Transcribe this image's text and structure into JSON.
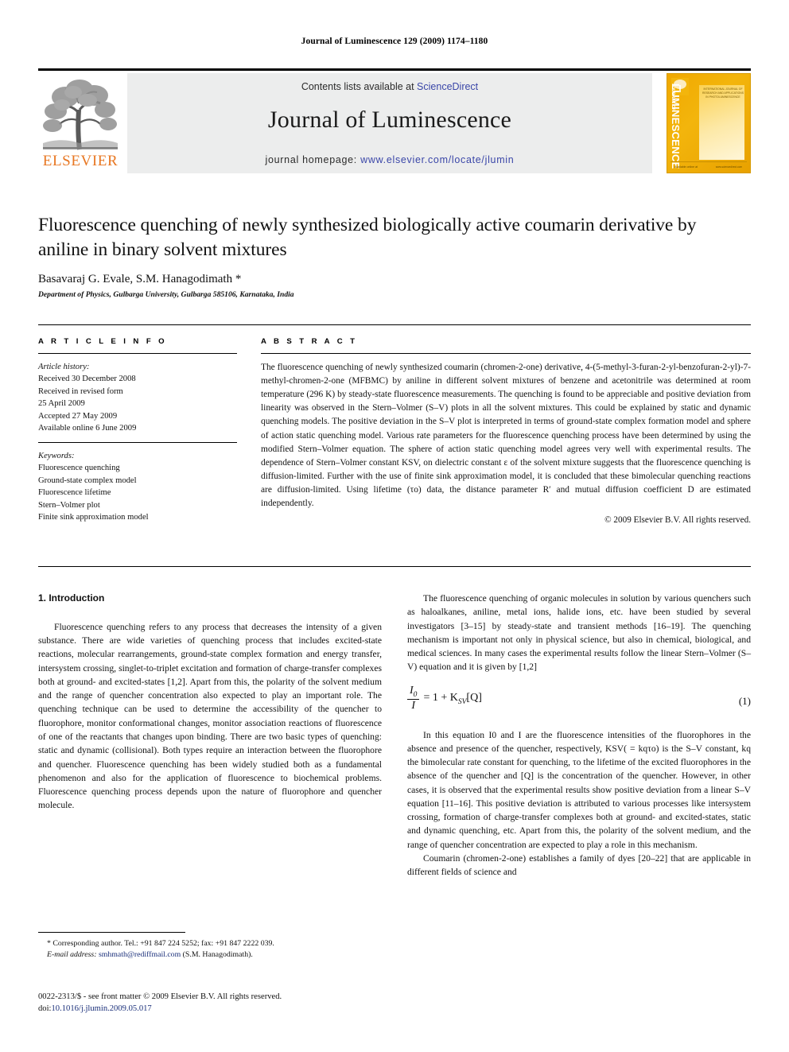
{
  "running_head": "Journal of Luminescence 129 (2009) 1174–1180",
  "masthead": {
    "contents_prefix": "Contents lists available at ",
    "sciencedirect": "ScienceDirect",
    "journal_title": "Journal of Luminescence",
    "homepage_prefix": "journal homepage: ",
    "homepage_url": "www.elsevier.com/locate/jlumin",
    "publisher_wordmark": "ELSEVIER",
    "cover_title_vertical": "LUMINESCENCE",
    "cover_title_small": "JOURNAL OF",
    "cover_top_note": "INTERNATIONAL JOURNAL OF RESEARCH AND APPLICATIONS IN PHOTOLUMINESCENCE",
    "cover_bottom_left": "Available online at",
    "cover_bottom_right": "www.sciencedirect.com",
    "link_color": "#3a46a8",
    "brand_orange": "#e87722",
    "cover_yellow": "#f0a800"
  },
  "article": {
    "title": "Fluorescence quenching of newly synthesized biologically active coumarin derivative by aniline in binary solvent mixtures",
    "authors": "Basavaraj G. Evale, S.M. Hanagodimath *",
    "affiliation": "Department of Physics, Gulbarga University, Gulbarga 585106, Karnataka, India"
  },
  "article_info": {
    "heading": "A R T I C L E  I N F O",
    "history_label": "Article history:",
    "history": [
      "Received 30 December 2008",
      "Received in revised form",
      "25 April 2009",
      "Accepted 27 May 2009",
      "Available online 6 June 2009"
    ],
    "keywords_label": "Keywords:",
    "keywords": [
      "Fluorescence quenching",
      "Ground-state complex model",
      "Fluorescence lifetime",
      "Stern–Volmer plot",
      "Finite sink approximation model"
    ]
  },
  "abstract": {
    "heading": "A B S T R A C T",
    "text": "The fluorescence quenching of newly synthesized coumarin (chromen-2-one) derivative, 4-(5-methyl-3-furan-2-yl-benzofuran-2-yl)-7-methyl-chromen-2-one (MFBMC) by aniline in different solvent mixtures of benzene and acetonitrile was determined at room temperature (296 K) by steady-state fluorescence measurements. The quenching is found to be appreciable and positive deviation from linearity was observed in the Stern–Volmer (S–V) plots in all the solvent mixtures. This could be explained by static and dynamic quenching models. The positive deviation in the S–V plot is interpreted in terms of ground-state complex formation model and sphere of action static quenching model. Various rate parameters for the fluorescence quenching process have been determined by using the modified Stern–Volmer equation. The sphere of action static quenching model agrees very well with experimental results. The dependence of Stern–Volmer constant KSV, on dielectric constant ε of the solvent mixture suggests that the fluorescence quenching is diffusion-limited. Further with the use of finite sink approximation model, it is concluded that these bimolecular quenching reactions are diffusion-limited. Using lifetime (τo) data, the distance parameter R′ and mutual diffusion coefficient D are estimated independently.",
    "copyright": "© 2009 Elsevier B.V. All rights reserved."
  },
  "body": {
    "section_heading": "1. Introduction",
    "left_para_1": "Fluorescence quenching refers to any process that decreases the intensity of a given substance. There are wide varieties of quenching process that includes excited-state reactions, molecular rearrangements, ground-state complex formation and energy transfer, intersystem crossing, singlet-to-triplet excitation and formation of charge-transfer complexes both at ground- and excited-states [1,2]. Apart from this, the polarity of the solvent medium and the range of quencher concentration also expected to play an important role. The quenching technique can be used to determine the accessibility of the quencher to fluorophore, monitor conformational changes, monitor association reactions of fluorescence of one of the reactants that changes upon binding. There are two basic types of quenching: static and dynamic (collisional). Both types require an interaction between the fluorophore and quencher. Fluorescence quenching has been widely studied both as a fundamental phenomenon and also for the application of fluorescence to biochemical problems. Fluorescence quenching process depends upon the nature of fluorophore and quencher molecule.",
    "right_para_1": "The fluorescence quenching of organic molecules in solution by various quenchers such as haloalkanes, aniline, metal ions, halide ions, etc. have been studied by several investigators [3–15] by steady-state and transient methods [16–19]. The quenching mechanism is important not only in physical science, but also in chemical, biological, and medical sciences. In many cases the experimental results follow the linear Stern–Volmer (S–V) equation and it is given by [1,2]",
    "equation": {
      "numerator": "I",
      "numerator_sub": "0",
      "denominator": "I",
      "rhs": "= 1 + K",
      "rhs_sub": "SV",
      "rhs_tail": "[Q]",
      "number": "(1)"
    },
    "right_para_2": "In this equation I0 and I are the fluorescence intensities of the fluorophores in the absence and presence of the quencher, respectively, KSV( = kqτo) is the S–V constant, kq the bimolecular rate constant for quenching, τo the lifetime of the excited fluorophores in the absence of the quencher and [Q] is the concentration of the quencher. However, in other cases, it is observed that the experimental results show positive deviation from a linear S–V equation [11–16]. This positive deviation is attributed to various processes like intersystem crossing, formation of charge-transfer complexes both at ground- and excited-states, static and dynamic quenching, etc. Apart from this, the polarity of the solvent medium, and the range of quencher concentration are expected to play a role in this mechanism.",
    "right_para_3": "Coumarin (chromen-2-one) establishes a family of dyes [20–22] that are applicable in different fields of science and"
  },
  "footer": {
    "corresponding": "* Corresponding author. Tel.: +91 847 224 5252; fax: +91 847 2222 039.",
    "email_label": "E-mail address:",
    "email": "smhmath@rediffmail.com",
    "email_owner": "(S.M. Hanagodimath).",
    "issn_line": "0022-2313/$ - see front matter © 2009 Elsevier B.V. All rights reserved.",
    "doi_label": "doi:",
    "doi_value": "10.1016/j.jlumin.2009.05.017"
  }
}
